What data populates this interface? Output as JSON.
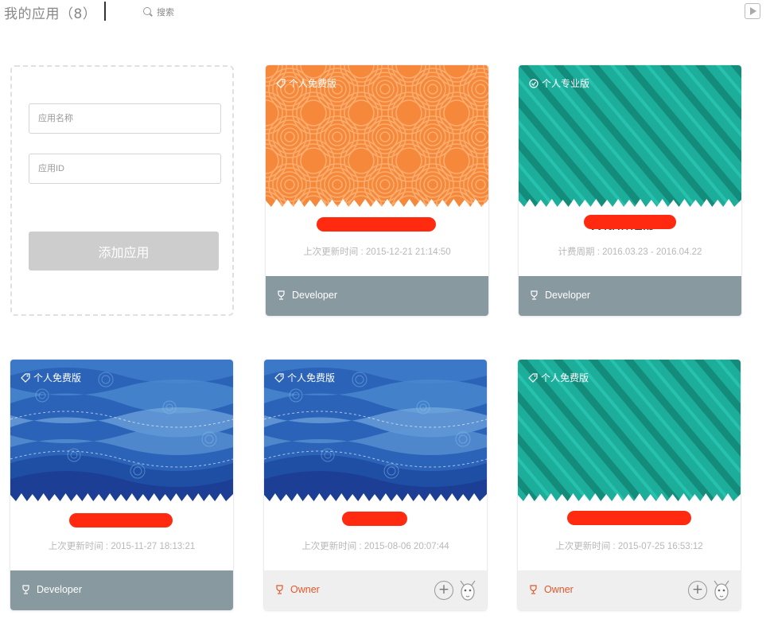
{
  "header": {
    "title": "我的应用（8）",
    "search_label": "搜索",
    "search_icon": "search-icon",
    "play_icon": "play-icon"
  },
  "add_form": {
    "name_placeholder": "应用名称",
    "id_placeholder": "应用ID",
    "submit_label": "添加应用"
  },
  "apps": [
    {
      "edition": "个人免费版",
      "edition_icon": "tag-icon",
      "banner": "orange-swirl",
      "name_visible": "",
      "time": "上次更新时间 : 2015-12-21 21:14:50",
      "role": "Developer",
      "role_style": "developer"
    },
    {
      "edition": "个人专业版",
      "edition_icon": "badge-icon",
      "banner": "teal-stripes",
      "name_visible": "WithMLib",
      "time": "计费周期 : 2016.03.23 - 2016.04.22",
      "role": "Developer",
      "role_style": "developer"
    },
    {
      "edition": "个人免费版",
      "edition_icon": "tag-icon",
      "banner": "blue-waves",
      "name_visible": "",
      "time": "上次更新时间 : 2015-11-27 18:13:21",
      "role": "Developer",
      "role_style": "developer"
    },
    {
      "edition": "个人免费版",
      "edition_icon": "tag-icon",
      "banner": "blue-waves",
      "name_visible": "",
      "time": "上次更新时间 : 2015-08-06 20:07:44",
      "role": "Owner",
      "role_style": "owner"
    },
    {
      "edition": "个人免费版",
      "edition_icon": "tag-icon",
      "banner": "teal-stripes",
      "name_visible": "",
      "time": "上次更新时间 : 2015-07-25 16:53:12",
      "role": "Owner",
      "role_style": "owner"
    }
  ],
  "colors": {
    "orange": "#f5883a",
    "teal": "#1dae9b",
    "blue": "#2a63b8",
    "developer_footer": "#8899a0",
    "owner_text": "#e2572b",
    "redaction": "#ff2a10"
  }
}
